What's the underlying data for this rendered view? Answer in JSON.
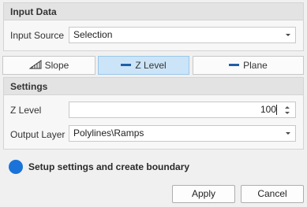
{
  "input_panel": {
    "title": "Input Data",
    "source_label": "Input Source",
    "source_value": "Selection"
  },
  "tabs": [
    {
      "label": "Slope",
      "icon": "slope-icon",
      "active": false
    },
    {
      "label": "Z Level",
      "icon": "line-icon",
      "active": true
    },
    {
      "label": "Plane",
      "icon": "line-icon",
      "active": false
    }
  ],
  "settings_panel": {
    "title": "Settings",
    "zlevel_label": "Z Level",
    "zlevel_value": "100",
    "output_label": "Output Layer",
    "output_value": "Polylines\\Ramps"
  },
  "status": {
    "text": "Setup settings and create boundary",
    "color": "#1a73d9"
  },
  "buttons": {
    "apply": "Apply",
    "cancel": "Cancel"
  },
  "colors": {
    "accent": "#1f5fa8",
    "active_tab": "#cce4f7"
  }
}
